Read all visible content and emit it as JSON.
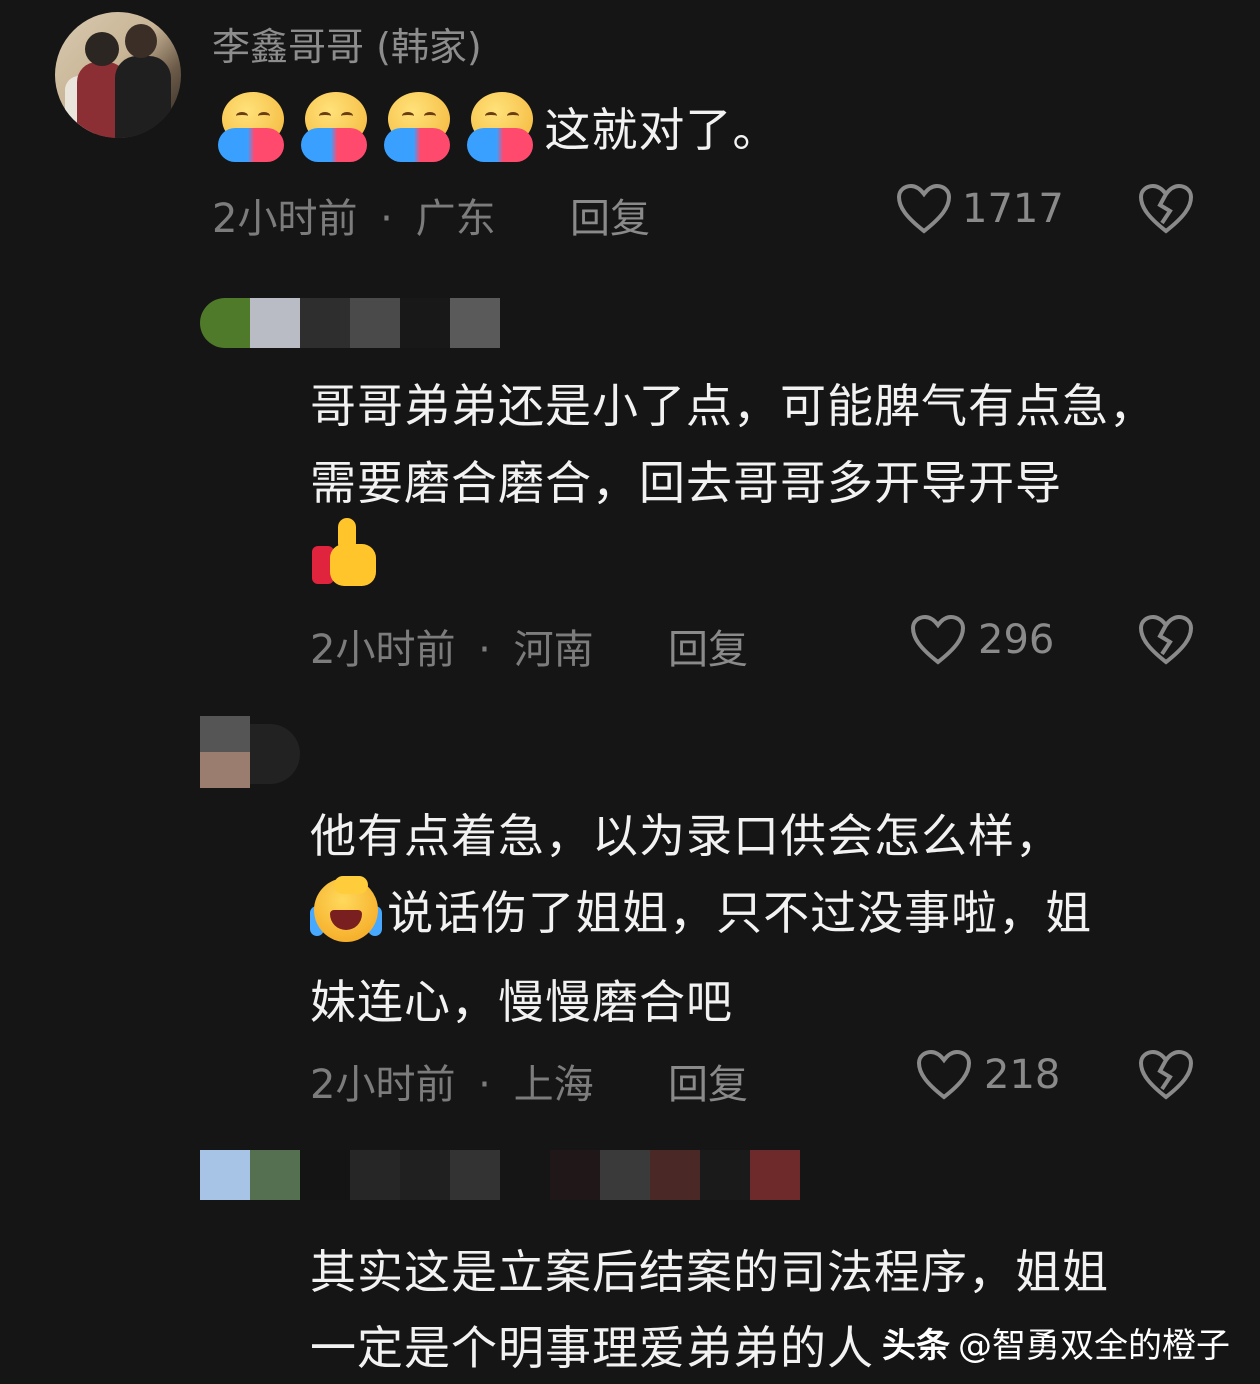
{
  "comments": [
    {
      "username": "李鑫哥哥 (韩家)",
      "text": "这就对了。",
      "emoji": "hugging-face-emoji",
      "time": "2小时前",
      "location": "广东",
      "reply_label": "回复",
      "likes": "1717"
    },
    {
      "lines": [
        "哥哥弟弟还是小了点，可能脾气有点急，",
        "需要磨合磨合，回去哥哥多开导开导"
      ],
      "emoji": "thumbs-up-emoji",
      "time": "2小时前",
      "location": "河南",
      "reply_label": "回复",
      "likes": "296"
    },
    {
      "lines": [
        "他有点着急，以为录口供会怎么样，",
        "说话伤了姐姐，只不过没事啦，姐",
        "妹连心，慢慢磨合吧"
      ],
      "emoji": "crying-face-emoji",
      "time": "2小时前",
      "location": "上海",
      "reply_label": "回复",
      "likes": "218"
    },
    {
      "lines": [
        "其实这是立案后结案的司法程序，姐姐",
        "一定是个明事理爱弟弟的人"
      ]
    }
  ],
  "separator": "·",
  "watermark": {
    "brand": "头条",
    "handle": "@智勇双全的橙子"
  }
}
